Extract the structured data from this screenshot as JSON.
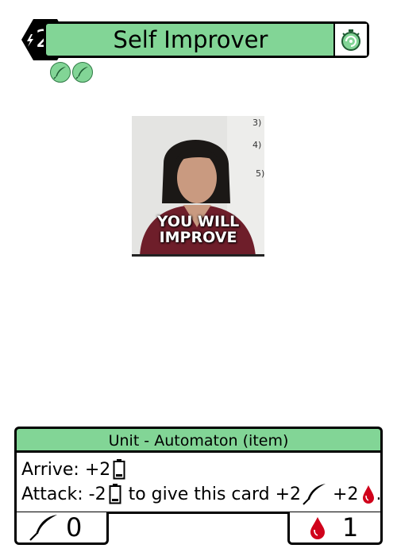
{
  "card": {
    "cost": "2",
    "name": "Self Improver",
    "type_line": "Unit - Automaton (item)",
    "art_caption": "YOU WILL\nIMPROVE",
    "ability_1_prefix": "Arrive: +2",
    "ability_2_prefix": "Attack: -2",
    "ability_2_mid": "to give this card +2",
    "ability_2_plus": "+2",
    "ability_2_end": ".",
    "attack": "0",
    "health": "1"
  },
  "icons": {
    "cost": "lightning-icon",
    "speed": "timer-icon",
    "keywords": [
      "quill-icon",
      "quill-icon"
    ],
    "battery": "battery-icon",
    "attack": "quill-icon",
    "health": "blood-drop-icon"
  },
  "colors": {
    "accent_green": "#82d596",
    "cost_hex": "#000000",
    "blood_red": "#d0021b"
  }
}
